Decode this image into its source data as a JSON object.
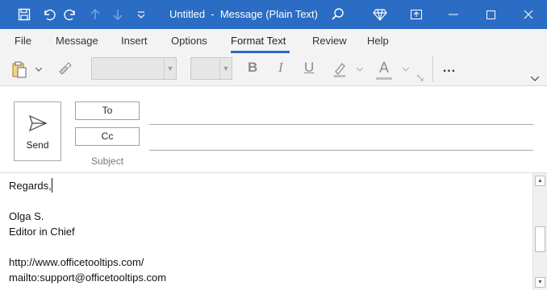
{
  "window": {
    "title": "Untitled  -  Message (Plain Text)"
  },
  "titlebar_icons": [
    "save-icon",
    "undo-icon",
    "redo-icon",
    "up-arrow-icon",
    "down-arrow-icon",
    "customize-qat-icon",
    "search-icon",
    "premium-diamond-icon"
  ],
  "menu": {
    "tabs": [
      "File",
      "Message",
      "Insert",
      "Options",
      "Format Text",
      "Review",
      "Help"
    ],
    "active": "Format Text"
  },
  "ribbon": {
    "bold": "B",
    "italic": "I",
    "underline": "U",
    "font_color": "A",
    "more": "..."
  },
  "compose": {
    "send_label": "Send",
    "to_label": "To",
    "cc_label": "Cc",
    "subject_label": "Subject"
  },
  "body": {
    "lines": [
      "Regards,",
      "",
      "Olga S.",
      "Editor in Chief",
      "",
      "http://www.officetooltips.com/",
      "mailto:support@officetooltips.com"
    ]
  },
  "colors": {
    "titlebar": "#2b6cc4",
    "ribbon_bg": "#f3f3f3",
    "accent": "#2b6cc4"
  }
}
